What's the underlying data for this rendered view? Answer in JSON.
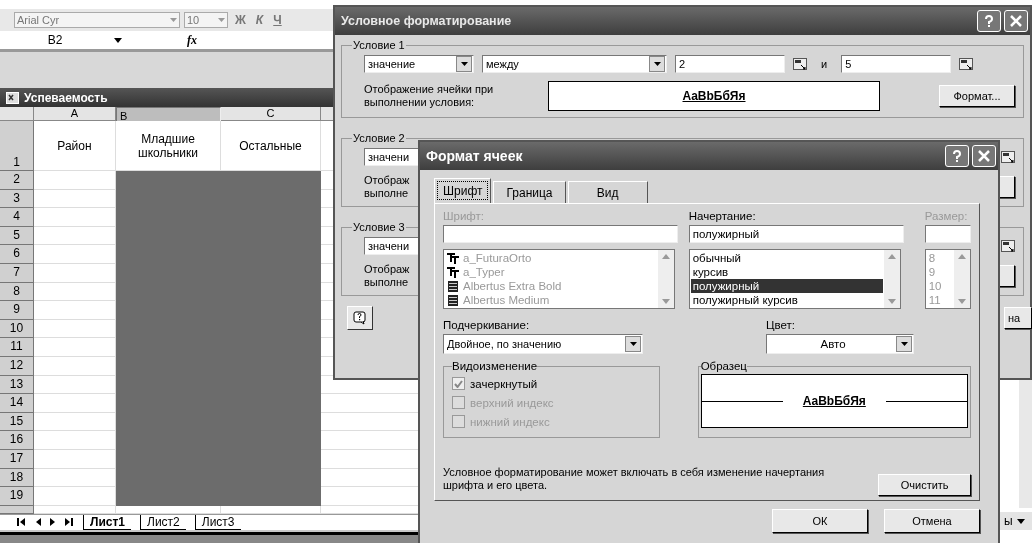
{
  "excel": {
    "font": "Arial Cyr",
    "font_size": "10",
    "format_buttons": [
      "Ж",
      "К",
      "Ч"
    ],
    "name_box": "B2",
    "formula_label": "fx",
    "workbook_title": "Успеваемость",
    "columns": [
      {
        "label": "A",
        "selected": false,
        "shaded": false
      },
      {
        "label": "B",
        "selected": true,
        "shaded": true
      },
      {
        "label": "C",
        "selected": false,
        "shaded": true
      }
    ],
    "header_row": {
      "number": "1",
      "cells": [
        "Район",
        "Младшие школьники",
        "Остальные"
      ]
    },
    "rows": [
      "2",
      "3",
      "4",
      "5",
      "6",
      "7",
      "8",
      "9",
      "10",
      "11",
      "12",
      "13",
      "14",
      "15",
      "16",
      "17",
      "18",
      "19"
    ],
    "sheet_tabs": [
      {
        "label": "Лист1",
        "selected": true
      },
      {
        "label": "Лист2",
        "selected": false
      },
      {
        "label": "Лист3",
        "selected": false
      }
    ],
    "toolbar_fragment": "ы"
  },
  "conditional_dialog": {
    "title": "Условное форматирование",
    "conditions": [
      {
        "label": "Условие 1",
        "type": "значение",
        "operator": "между",
        "value1": "2",
        "joiner": "и",
        "value2": "5",
        "caption": "Отображение ячейки при выполнении условия:",
        "preview": "AaBbБбЯя",
        "format_button": "Формат..."
      },
      {
        "label": "Условие 2",
        "type": "значени",
        "caption_lines": [
          "Отображ",
          "выполне"
        ]
      },
      {
        "label": "Условие 3",
        "type": "значени",
        "caption_lines": [
          "Отображ",
          "выполне"
        ]
      }
    ],
    "cancel_fragment": "на"
  },
  "format_dialog": {
    "title": "Формат ячеек",
    "tabs": [
      {
        "label": "Шрифт",
        "selected": true
      },
      {
        "label": "Граница",
        "selected": false
      },
      {
        "label": "Вид",
        "selected": false
      }
    ],
    "font": {
      "label": "Шрифт:",
      "disabled": true,
      "items": [
        {
          "label": "a_FuturaOrto",
          "kind": "truetype"
        },
        {
          "label": "a_Typer",
          "kind": "truetype"
        },
        {
          "label": "Albertus Extra Bold",
          "kind": "printer"
        },
        {
          "label": "Albertus Medium",
          "kind": "printer"
        }
      ]
    },
    "style": {
      "label": "Начертание:",
      "value": "полужирный",
      "items": [
        {
          "label": "обычный",
          "selected": false
        },
        {
          "label": "курсив",
          "selected": false
        },
        {
          "label": "полужирный",
          "selected": true
        },
        {
          "label": "полужирный курсив",
          "selected": false
        }
      ]
    },
    "size": {
      "label": "Размер:",
      "disabled": true,
      "items": [
        "8",
        "9",
        "10",
        "11"
      ]
    },
    "underline": {
      "label": "Подчеркивание:",
      "value": "Двойное, по значению"
    },
    "color": {
      "label": "Цвет:",
      "value": "Авто"
    },
    "effects": {
      "title": "Видоизменение",
      "items": [
        {
          "label": "зачеркнутый",
          "checked": true,
          "disabled": false
        },
        {
          "label": "верхний индекс",
          "checked": false,
          "disabled": true
        },
        {
          "label": "нижний индекс",
          "checked": false,
          "disabled": true
        }
      ]
    },
    "sample": {
      "title": "Образец",
      "text": "AaBbБбЯя"
    },
    "note": "Условное форматирование может включать в себя изменение начертания шрифта и его цвета.",
    "clear_button": "Очистить",
    "ok_button": "ОК",
    "cancel_button": "Отмена"
  }
}
